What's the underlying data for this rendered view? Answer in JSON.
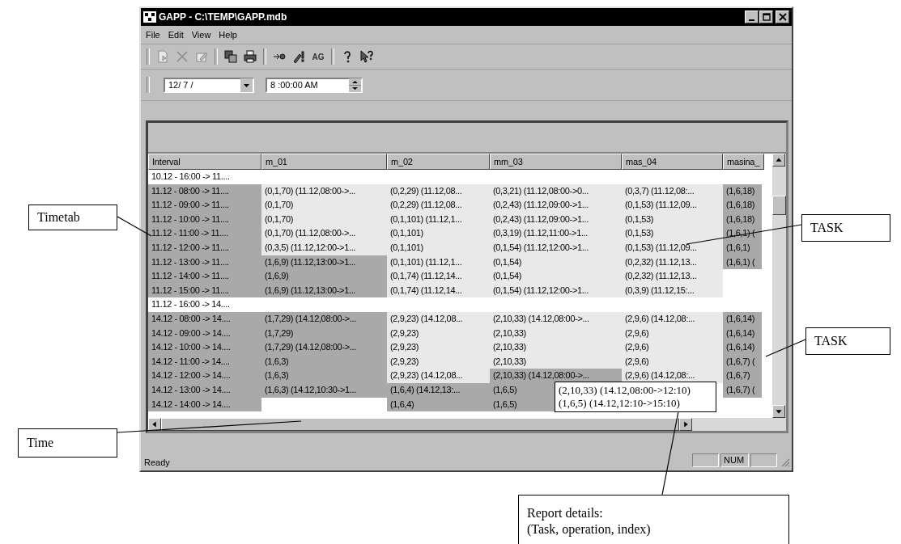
{
  "window": {
    "title": "GAPP - C:\\TEMP\\GAPP.mdb"
  },
  "menu": [
    {
      "label": "File"
    },
    {
      "label": "Edit"
    },
    {
      "label": "View"
    },
    {
      "label": "Help"
    }
  ],
  "toolbar": [
    [
      {
        "kind": "new",
        "disabled": true
      },
      {
        "kind": "delete",
        "disabled": true
      },
      {
        "kind": "edit",
        "disabled": true
      }
    ],
    [
      {
        "kind": "copy",
        "disabled": false
      },
      {
        "kind": "print",
        "disabled": false
      }
    ],
    [
      {
        "kind": "run",
        "disabled": false
      },
      {
        "kind": "run-all",
        "disabled": false
      },
      {
        "kind": "text",
        "label": "AG",
        "disabled": false
      }
    ],
    [
      {
        "kind": "help",
        "disabled": false
      },
      {
        "kind": "context-help",
        "disabled": false
      }
    ]
  ],
  "date_field": {
    "value": "12/ 7 /"
  },
  "time_field": {
    "value": "8 :00:00 AM"
  },
  "grid": {
    "columns": [
      "Interval",
      "m_01",
      "m_02",
      "mm_03",
      "mas_04",
      "masina_"
    ],
    "rows": [
      {
        "kind": "separator",
        "cells": [
          {
            "text": "10.12 - 16:00 -> 11...."
          }
        ]
      },
      {
        "kind": "data",
        "cells": [
          {
            "text": "11.12 - 08:00 -> 11....",
            "highlighted": true
          },
          {
            "text": "(0,1,70) (11.12,08:00->...",
            "highlighted": false
          },
          {
            "text": "(0,2,29) (11.12,08...",
            "highlighted": false
          },
          {
            "text": "(0,3,21) (11.12,08:00->0...",
            "highlighted": false
          },
          {
            "text": "(0,3,7) (11.12,08:...",
            "highlighted": false
          },
          {
            "text": "(1,6,18)",
            "highlighted": true
          }
        ]
      },
      {
        "kind": "data",
        "cells": [
          {
            "text": "11.12 - 09:00 -> 11....",
            "highlighted": true
          },
          {
            "text": "(0,1,70)",
            "highlighted": false
          },
          {
            "text": "(0,2,29) (11.12,08...",
            "highlighted": false
          },
          {
            "text": "(0,2,43) (11.12,09:00->1...",
            "highlighted": false
          },
          {
            "text": "(0,1,53) (11.12,09...",
            "highlighted": false
          },
          {
            "text": "(1,6,18)",
            "highlighted": true
          }
        ]
      },
      {
        "kind": "data",
        "cells": [
          {
            "text": "11.12 - 10:00 -> 11....",
            "highlighted": true
          },
          {
            "text": "(0,1,70)",
            "highlighted": false
          },
          {
            "text": "(0,1,101) (11.12,1...",
            "highlighted": false
          },
          {
            "text": "(0,2,43) (11.12,09:00->1...",
            "highlighted": false
          },
          {
            "text": "(0,1,53)",
            "highlighted": false
          },
          {
            "text": "(1,6,18)",
            "highlighted": true
          }
        ]
      },
      {
        "kind": "data",
        "cells": [
          {
            "text": "11.12 - 11:00 -> 11....",
            "highlighted": true
          },
          {
            "text": "(0,1,70) (11.12,08:00->...",
            "highlighted": false
          },
          {
            "text": "(0,1,101)",
            "highlighted": false
          },
          {
            "text": "(0,3,19) (11.12,11:00->1...",
            "highlighted": false
          },
          {
            "text": "(0,1,53)",
            "highlighted": false
          },
          {
            "text": "(1,6,1) (",
            "highlighted": true
          }
        ]
      },
      {
        "kind": "data",
        "cells": [
          {
            "text": "11.12 - 12:00 -> 11....",
            "highlighted": true
          },
          {
            "text": "(0,3,5) (11.12,12:00->1...",
            "highlighted": false
          },
          {
            "text": "(0,1,101)",
            "highlighted": false
          },
          {
            "text": "(0,1,54) (11.12,12:00->1...",
            "highlighted": false
          },
          {
            "text": "(0,1,53) (11.12,09...",
            "highlighted": false
          },
          {
            "text": "(1,6,1)",
            "highlighted": true
          }
        ]
      },
      {
        "kind": "data",
        "cells": [
          {
            "text": "11.12 - 13:00 -> 11....",
            "highlighted": true
          },
          {
            "text": "(1,6,9) (11.12,13:00->1...",
            "highlighted": true
          },
          {
            "text": "(0,1,101) (11.12,1...",
            "highlighted": false
          },
          {
            "text": "(0,1,54)",
            "highlighted": false
          },
          {
            "text": "(0,2,32) (11.12,13...",
            "highlighted": false
          },
          {
            "text": "(1,6,1) (",
            "highlighted": true
          }
        ]
      },
      {
        "kind": "data",
        "cells": [
          {
            "text": "11.12 - 14:00 -> 11....",
            "highlighted": true
          },
          {
            "text": "(1,6,9)",
            "highlighted": true
          },
          {
            "text": "(0,1,74) (11.12,14...",
            "highlighted": false
          },
          {
            "text": "(0,1,54)",
            "highlighted": false
          },
          {
            "text": "(0,2,32) (11.12,13...",
            "highlighted": false
          },
          null
        ]
      },
      {
        "kind": "data",
        "cells": [
          {
            "text": "11.12 - 15:00 -> 11....",
            "highlighted": true
          },
          {
            "text": "(1,6,9) (11.12,13:00->1...",
            "highlighted": true
          },
          {
            "text": "(0,1,74) (11.12,14...",
            "highlighted": false
          },
          {
            "text": "(0,1,54) (11.12,12:00->1...",
            "highlighted": false
          },
          {
            "text": "(0,3,9) (11.12,15:...",
            "highlighted": false
          },
          null
        ]
      },
      {
        "kind": "separator",
        "cells": [
          {
            "text": "11.12 - 16:00 -> 14...."
          }
        ]
      },
      {
        "kind": "data",
        "cells": [
          {
            "text": "14.12 - 08:00 -> 14....",
            "highlighted": true
          },
          {
            "text": "(1,7,29) (14.12,08:00->...",
            "highlighted": true
          },
          {
            "text": "(2,9,23) (14.12,08...",
            "highlighted": false
          },
          {
            "text": "(2,10,33) (14.12,08:00->...",
            "highlighted": false
          },
          {
            "text": "(2,9,6) (14.12,08:...",
            "highlighted": false
          },
          {
            "text": "(1,6,14)",
            "highlighted": true
          }
        ]
      },
      {
        "kind": "data",
        "cells": [
          {
            "text": "14.12 - 09:00 -> 14....",
            "highlighted": true
          },
          {
            "text": "(1,7,29)",
            "highlighted": true
          },
          {
            "text": "(2,9,23)",
            "highlighted": false
          },
          {
            "text": "(2,10,33)",
            "highlighted": false
          },
          {
            "text": "(2,9,6)",
            "highlighted": false
          },
          {
            "text": "(1,6,14)",
            "highlighted": true
          }
        ]
      },
      {
        "kind": "data",
        "cells": [
          {
            "text": "14.12 - 10:00 -> 14....",
            "highlighted": true
          },
          {
            "text": "(1,7,29) (14.12,08:00->...",
            "highlighted": true
          },
          {
            "text": "(2,9,23)",
            "highlighted": false
          },
          {
            "text": "(2,10,33)",
            "highlighted": false
          },
          {
            "text": "(2,9,6)",
            "highlighted": false
          },
          {
            "text": "(1,6,14)",
            "highlighted": true
          }
        ]
      },
      {
        "kind": "data",
        "cells": [
          {
            "text": "14.12 - 11:00 -> 14....",
            "highlighted": true
          },
          {
            "text": "(1,6,3)",
            "highlighted": true
          },
          {
            "text": "(2,9,23)",
            "highlighted": false
          },
          {
            "text": "(2,10,33)",
            "highlighted": false
          },
          {
            "text": "(2,9,6)",
            "highlighted": false
          },
          {
            "text": "(1,6,7) (",
            "highlighted": true
          }
        ]
      },
      {
        "kind": "data",
        "cells": [
          {
            "text": "14.12 - 12:00 -> 14....",
            "highlighted": true
          },
          {
            "text": "(1,6,3)",
            "highlighted": true
          },
          {
            "text": "(2,9,23) (14.12,08...",
            "highlighted": false
          },
          {
            "text": "(2,10,33) (14.12,08:00->...",
            "highlighted": true
          },
          {
            "text": "(2,9,6) (14.12,08:...",
            "highlighted": false
          },
          {
            "text": "(1,6,7)",
            "highlighted": true
          }
        ]
      },
      {
        "kind": "data",
        "cells": [
          {
            "text": "14.12 - 13:00 -> 14....",
            "highlighted": true
          },
          {
            "text": "(1,6,3) (14.12,10:30->1...",
            "highlighted": true
          },
          {
            "text": "(1,6,4) (14.12,13:...",
            "highlighted": true
          },
          {
            "text": "(1,6,5)",
            "highlighted": true
          },
          null,
          {
            "text": "(1,6,7) (",
            "highlighted": true
          }
        ]
      },
      {
        "kind": "data",
        "cells": [
          {
            "text": "14.12 - 14:00 -> 14....",
            "highlighted": true
          },
          null,
          {
            "text": "(1,6,4)",
            "highlighted": true
          },
          {
            "text": "(1,6,5)",
            "highlighted": true
          },
          null,
          null
        ]
      }
    ]
  },
  "tooltip": {
    "lines": [
      "(2,10,33) (14.12,08:00->12:10)",
      "(1,6,5) (14.12,12:10->15:10)"
    ]
  },
  "status_bar": {
    "message": "Ready",
    "indicator": "NUM"
  },
  "annotations": [
    {
      "text": "Timetab"
    },
    {
      "text": "TASK"
    },
    {
      "text": "TASK"
    },
    {
      "text": "Time"
    },
    {
      "text": "Report details:"
    },
    {
      "text": "(Task, operation, index)"
    }
  ]
}
